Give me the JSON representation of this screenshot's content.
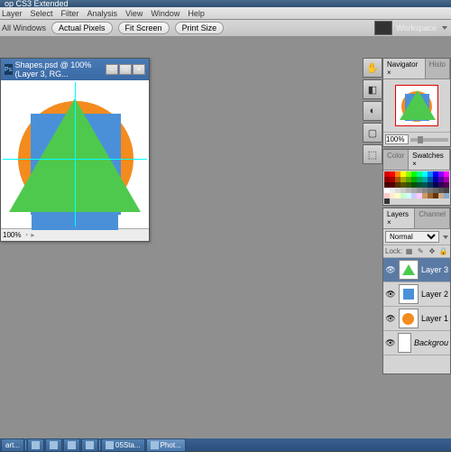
{
  "titlebar": "op CS3 Extended",
  "menu": {
    "layer": "Layer",
    "select": "Select",
    "filter": "Filter",
    "analysis": "Analysis",
    "view": "View",
    "window": "Window",
    "help": "Help"
  },
  "options": {
    "all_windows": "All Windows",
    "actual_pixels": "Actual Pixels",
    "fit_screen": "Fit Screen",
    "print_size": "Print Size"
  },
  "workspace_label": "Workspace",
  "doc": {
    "title": "Shapes.psd @ 100% (Layer 3, RG...",
    "zoom": "100%"
  },
  "nav": {
    "tab": "Navigator",
    "tab2": "Histo",
    "zoom": "100%"
  },
  "color": {
    "tab": "Color",
    "tab2": "Swatches"
  },
  "layers": {
    "tab": "Layers",
    "tab2": "Channel",
    "blend": "Normal",
    "lock": "Lock:",
    "items": [
      {
        "name": "Layer 3"
      },
      {
        "name": "Layer 2"
      },
      {
        "name": "Layer 1"
      },
      {
        "name": "Backgrou"
      }
    ]
  },
  "taskbar": {
    "start": "art...",
    "i1": "05Sta...",
    "i2": "Phot..."
  },
  "swatches": [
    "#d40000",
    "#f00",
    "#f80",
    "#ff0",
    "#8f0",
    "#0f0",
    "#0f8",
    "#0ff",
    "#08f",
    "#00f",
    "#80f",
    "#f0f",
    "#800",
    "#a00",
    "#a50",
    "#aa0",
    "#5a0",
    "#0a0",
    "#0a5",
    "#0aa",
    "#05a",
    "#00a",
    "#50a",
    "#a0a",
    "#400",
    "#500",
    "#530",
    "#550",
    "#350",
    "#050",
    "#053",
    "#055",
    "#035",
    "#005",
    "#305",
    "#505",
    "#fff",
    "#eee",
    "#ddd",
    "#ccc",
    "#bbb",
    "#aaa",
    "#999",
    "#888",
    "#777",
    "#666",
    "#555",
    "#444",
    "#fcc",
    "#fec",
    "#ffc",
    "#cfc",
    "#cff",
    "#ccf",
    "#fcf",
    "#c96",
    "#963",
    "#630",
    "#ca8",
    "#8ac",
    "#333"
  ]
}
